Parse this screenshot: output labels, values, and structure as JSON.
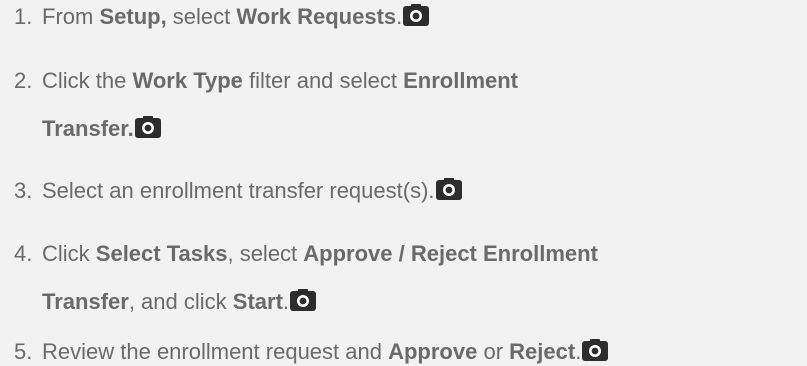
{
  "steps": [
    {
      "number": "1.",
      "lines": [
        [
          {
            "t": "From ",
            "b": false
          },
          {
            "t": "Setup,",
            "b": true
          },
          {
            "t": " select ",
            "b": false
          },
          {
            "t": "Work Requests",
            "b": true
          },
          {
            "t": ".",
            "b": false
          }
        ]
      ],
      "icon": "camera-icon"
    },
    {
      "number": "2.",
      "lines": [
        [
          {
            "t": "Click the ",
            "b": false
          },
          {
            "t": "Work Type",
            "b": true
          },
          {
            "t": " filter and select ",
            "b": false
          },
          {
            "t": "Enrollment",
            "b": true
          }
        ],
        [
          {
            "t": "Transfer.",
            "b": true
          }
        ]
      ],
      "icon": "camera-icon"
    },
    {
      "number": "3.",
      "lines": [
        [
          {
            "t": "Select an enrollment transfer request(s).",
            "b": false
          }
        ]
      ],
      "icon": "camera-icon"
    },
    {
      "number": "4.",
      "lines": [
        [
          {
            "t": "Click ",
            "b": false
          },
          {
            "t": "Select Tasks",
            "b": true
          },
          {
            "t": ", select ",
            "b": false
          },
          {
            "t": "Approve / Reject Enrollment",
            "b": true
          }
        ],
        [
          {
            "t": "Transfer",
            "b": true
          },
          {
            "t": ", and click ",
            "b": false
          },
          {
            "t": "Start",
            "b": true
          },
          {
            "t": ".",
            "b": false
          }
        ]
      ],
      "icon": "camera-icon"
    },
    {
      "number": "5.",
      "lines": [
        [
          {
            "t": "Review the enrollment request and ",
            "b": false
          },
          {
            "t": "Approve",
            "b": true
          },
          {
            "t": " or ",
            "b": false
          },
          {
            "t": "Reject",
            "b": true
          },
          {
            "t": ".",
            "b": false
          }
        ]
      ],
      "icon": "camera-icon"
    }
  ],
  "colors": {
    "background": "#f2f2f2",
    "text": "#6a6a6a",
    "icon_bg": "#2d2d2d",
    "icon_fg": "#ffffff"
  }
}
